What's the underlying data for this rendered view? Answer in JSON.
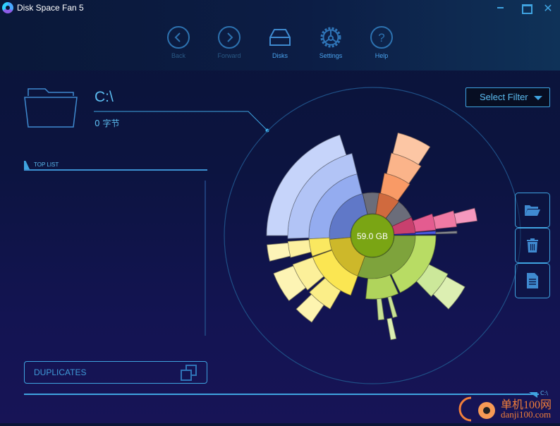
{
  "window": {
    "title": "Disk Space Fan 5",
    "controls": {
      "minimize": "minimize",
      "maximize": "maximize",
      "close": "✕"
    }
  },
  "nav": [
    {
      "label": "Back",
      "icon": "chevron-left-circle-icon",
      "enabled": false
    },
    {
      "label": "Forward",
      "icon": "chevron-right-circle-icon",
      "enabled": false
    },
    {
      "label": "Disks",
      "icon": "disk-drive-icon",
      "enabled": true
    },
    {
      "label": "Settings",
      "icon": "gear-icon",
      "enabled": true
    },
    {
      "label": "Help",
      "icon": "help-circle-icon",
      "enabled": true
    }
  ],
  "current": {
    "path": "C:\\",
    "size": "0 字节"
  },
  "toplist": {
    "label": "TOP LIST",
    "items": []
  },
  "duplicates": {
    "label": "DUPLICATES"
  },
  "progress": {
    "end_label": "C:\\"
  },
  "filter": {
    "label": "Select Filter"
  },
  "side_actions": [
    {
      "name": "open-folder",
      "icon": "folder-open-icon"
    },
    {
      "name": "delete",
      "icon": "trash-icon"
    },
    {
      "name": "report",
      "icon": "document-icon"
    }
  ],
  "watermark": {
    "line1": "单机100网",
    "line2": "danji100.com"
  },
  "colors": {
    "accent": "#3fa3e0",
    "center": "#7aa514",
    "blue_ring": "#6078c8",
    "orange_ring": "#d06a3e",
    "yellow_ring": "#cdb82a",
    "green_ring": "#7ea33c",
    "gray_ring": "#6b6d7a",
    "pink_ring": "#c8406e"
  },
  "chart_data": {
    "type": "sunburst",
    "title": "",
    "total_label": "59.0 GB",
    "rings": [
      {
        "level": 1,
        "segments": [
          {
            "start": -5,
            "end": 77,
            "color": "#6078c8"
          },
          {
            "start": 77,
            "end": 99,
            "color": "#6b6d7a"
          },
          {
            "start": 99,
            "end": 128,
            "color": "#d06a3e"
          },
          {
            "start": 128,
            "end": 155,
            "color": "#6b6d7a"
          },
          {
            "start": 155,
            "end": 177,
            "color": "#c8406e"
          },
          {
            "start": 177,
            "end": 179,
            "color": "#2430c8"
          },
          {
            "start": 180,
            "end": 290,
            "color": "#7ea33c"
          },
          {
            "start": 290,
            "end": 355,
            "color": "#cdb82a"
          }
        ]
      },
      {
        "level": 2,
        "segments": [
          {
            "start": -3,
            "end": 76,
            "color": "#94acf0"
          },
          {
            "start": 101,
            "end": 126,
            "color": "#f99a66"
          },
          {
            "start": 160,
            "end": 175,
            "color": "#e45c90"
          },
          {
            "start": 176,
            "end": 178.5,
            "color": "#4a5ae8"
          },
          {
            "start": 180,
            "end": 244,
            "color": "#b8dc64"
          },
          {
            "start": 246,
            "end": 276,
            "color": "#b0d45c"
          },
          {
            "start": 290,
            "end": 340,
            "color": "#fbe652"
          },
          {
            "start": 341,
            "end": 357,
            "color": "#fae860"
          }
        ]
      },
      {
        "level": 3,
        "segments": [
          {
            "start": -2,
            "end": 76,
            "color": "#b2c4f6"
          },
          {
            "start": 103,
            "end": 125,
            "color": "#fbb48a"
          },
          {
            "start": 163,
            "end": 174,
            "color": "#f07aa4"
          },
          {
            "start": 177,
            "end": 178.5,
            "color": "#8a8c94"
          },
          {
            "start": 207,
            "end": 226,
            "color": "#cce89a"
          },
          {
            "start": 253,
            "end": 256,
            "color": "#c8e294"
          },
          {
            "start": 262,
            "end": 266,
            "color": "#c8e294"
          },
          {
            "start": 300,
            "end": 318,
            "color": "#fbee88"
          },
          {
            "start": 320,
            "end": 340,
            "color": "#fcf09a"
          },
          {
            "start": 345,
            "end": 356,
            "color": "#fcf0a0"
          }
        ]
      },
      {
        "level": 4,
        "segments": [
          {
            "start": 0,
            "end": 72,
            "color": "#c6d4fa"
          },
          {
            "start": 104,
            "end": 123,
            "color": "#fcc6a4"
          },
          {
            "start": 165,
            "end": 172,
            "color": "#f598be"
          },
          {
            "start": 209,
            "end": 224,
            "color": "#dcefb2"
          },
          {
            "start": 257,
            "end": 260,
            "color": "#dcefb2"
          },
          {
            "start": 305,
            "end": 316,
            "color": "#fdf4b0"
          },
          {
            "start": 322,
            "end": 339,
            "color": "#fdf4b4"
          },
          {
            "start": 346,
            "end": 355,
            "color": "#fdf4b8"
          }
        ]
      }
    ]
  }
}
